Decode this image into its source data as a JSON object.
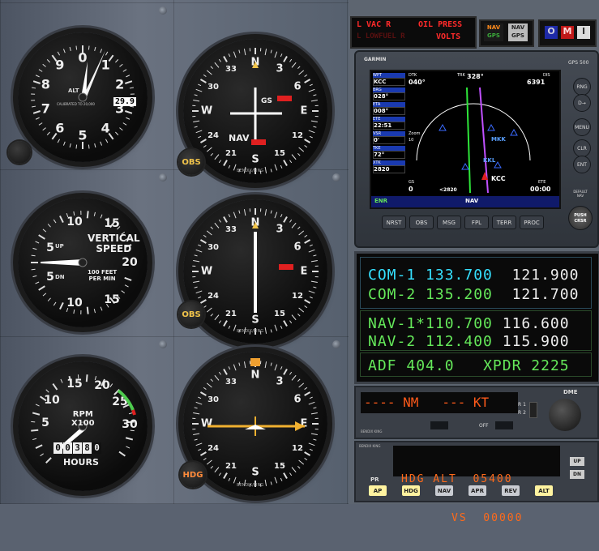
{
  "annunciators": {
    "l_vac_r": "L VAC R",
    "oil_press": "OIL PRESS",
    "l_lowfuel_r": "L LOWFUEL R",
    "volts": "VOLTS"
  },
  "switches": {
    "nav": "NAV",
    "gps": "GPS",
    "omi": [
      "O",
      "M",
      "I"
    ]
  },
  "colors": {
    "red": "#ff2a2a",
    "amber": "#ff7a1a",
    "cyan": "#35e0ff",
    "green": "#65e85a",
    "orange_knob": "#ff8a3a"
  },
  "altimeter": {
    "label": "ALT",
    "sub": "CALIBRATED TO 20,000",
    "kollsman": "29.9",
    "digits": [
      "0",
      "1",
      "2",
      "3",
      "4",
      "5",
      "6",
      "7",
      "8",
      "9"
    ]
  },
  "vsi": {
    "title1": "VERTICAL",
    "title2": "SPEED",
    "sub1": "100 FEET",
    "sub2": "PER MIN",
    "up": "UP",
    "dn": "DN",
    "ticks": [
      "5",
      "10",
      "15",
      "20",
      "15",
      "10",
      "5"
    ]
  },
  "tach": {
    "rpm": "RPM",
    "x100": "X100",
    "hours_label": "HOURS",
    "hobbs": [
      "0",
      "0",
      "3",
      "8",
      "0"
    ],
    "ticks": [
      "5",
      "10",
      "15",
      "20",
      "25",
      "30"
    ]
  },
  "vor1": {
    "card": [
      "33",
      "N",
      "3",
      "6",
      "E",
      "12",
      "15",
      "S",
      "21",
      "24",
      "W",
      "30"
    ],
    "gs": "GS",
    "nav": "NAV",
    "obs": "OBS",
    "brand": "BENDIX/KING"
  },
  "vor2": {
    "card": [
      "33",
      "N",
      "3",
      "6",
      "E",
      "12",
      "15",
      "S",
      "21",
      "24",
      "W",
      "30"
    ],
    "obs": "OBS",
    "brand": "BENDIX/KING"
  },
  "hsi": {
    "card": [
      "N",
      "3",
      "6",
      "E",
      "12",
      "15",
      "S",
      "21",
      "24",
      "W",
      "30",
      "33"
    ],
    "hdg": "HDG",
    "brand": "BENDIX/KING"
  },
  "gps": {
    "brand": "GARMIN",
    "model": "GPS 500",
    "fields": [
      {
        "k": "WPT",
        "v": "KCC"
      },
      {
        "k": "BRG",
        "v": "028°"
      },
      {
        "k": "ETA",
        "v": "008°"
      },
      {
        "k": "ETE",
        "v": "22:51"
      },
      {
        "k": "VSR",
        "v": "0'"
      },
      {
        "k": "TKE",
        "v": "72°"
      },
      {
        "k": "XTK",
        "v": "2820"
      }
    ],
    "dtk": "DTK",
    "dtk_val": "040°",
    "trk": "TRK",
    "trk_val": "328°",
    "dis": "DIS",
    "dis_val": "6391",
    "gs": "GS",
    "gs_val": "0",
    "kcc": "KCC",
    "ete": "ETE",
    "ete_val": "00:00",
    "range": "<2820",
    "wpt_labels": [
      "MKK",
      "KKL"
    ],
    "zoom": "Zoom",
    "zoom_val": "10",
    "bottom": {
      "enr": "ENR",
      "nav": "NAV"
    },
    "soft": [
      "NRST",
      "OBS",
      "MSG",
      "FPL",
      "TERR",
      "PROC"
    ],
    "right": [
      "RNG",
      "D→",
      "MENU",
      "CLR",
      "ENT"
    ],
    "default_nav": "DEFAULT NAV",
    "push": "PUSH",
    "crsr": "CRSR"
  },
  "radio": {
    "com1": {
      "label": "COM-1",
      "active": "133.700",
      "standby": "121.900"
    },
    "com2": {
      "label": "COM-2",
      "active": "135.200",
      "standby": "121.700"
    },
    "nav1": {
      "label": "NAV-1*",
      "active": "110.700",
      "standby": "116.600"
    },
    "nav2": {
      "label": "NAV-2",
      "active": "112.400",
      "standby": "115.900"
    },
    "adf": {
      "label": "ADF",
      "value": "404.0"
    },
    "xpdr": {
      "label": "XPDR",
      "value": "2225"
    }
  },
  "dme": {
    "title": "DME",
    "display": "---- NM   --- KT",
    "r1": "R 1",
    "r2": "R 2",
    "off": "OFF",
    "brand": "BENDIX KING"
  },
  "autopilot": {
    "brand": "BENDIX KING",
    "line1": "HDG ALT  05400",
    "line2": "VS  00000",
    "pr": "PR",
    "up": "UP",
    "dn": "DN",
    "buttons": [
      {
        "label": "AP",
        "on": true
      },
      {
        "label": "HDG",
        "on": true
      },
      {
        "label": "NAV",
        "on": false
      },
      {
        "label": "APR",
        "on": false
      },
      {
        "label": "REV",
        "on": false
      },
      {
        "label": "ALT",
        "on": true
      }
    ]
  }
}
